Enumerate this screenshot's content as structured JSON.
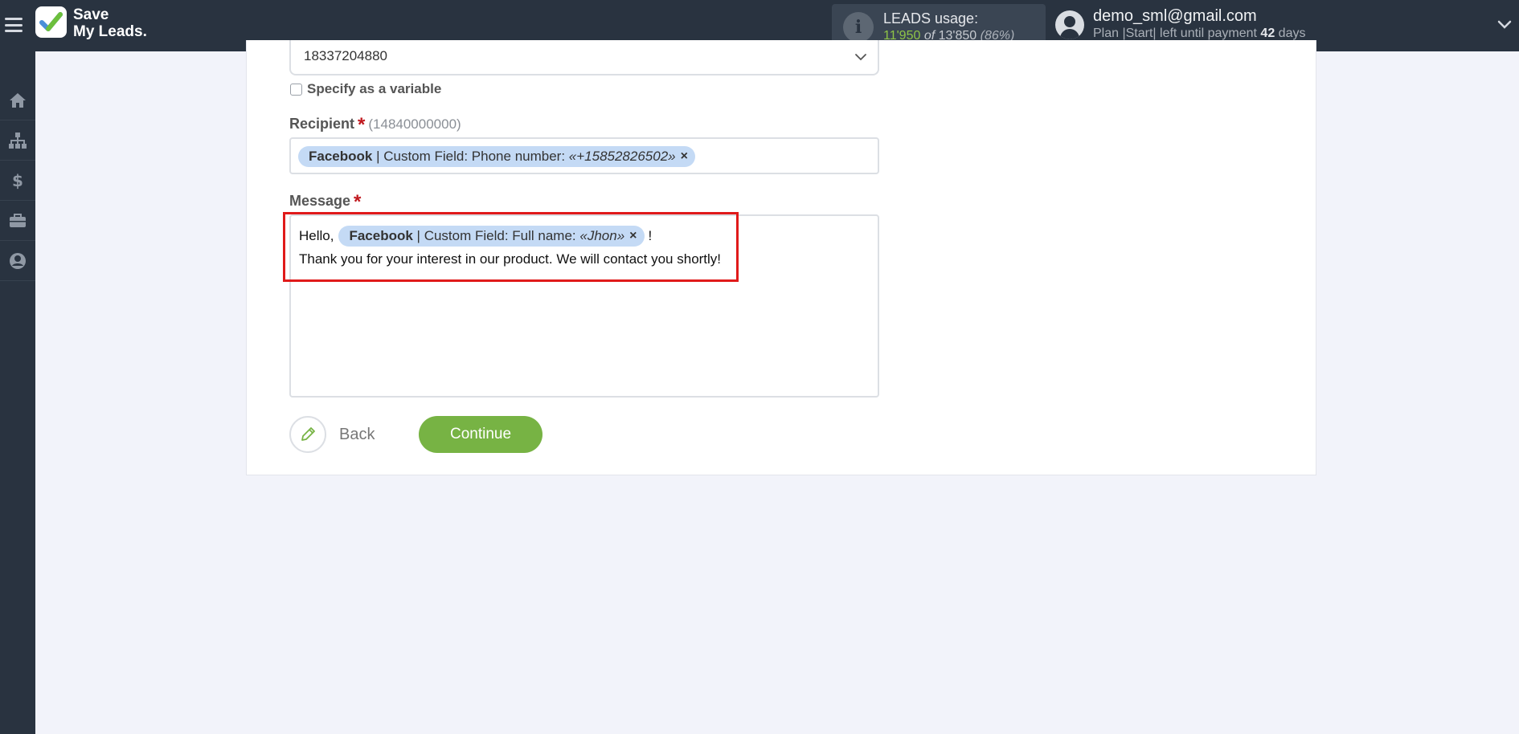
{
  "brand": {
    "line1": "Save",
    "line2": "My Leads."
  },
  "usage": {
    "title": "LEADS usage:",
    "used": "11'950",
    "of_word": "of",
    "total": "13'850",
    "percent": "(86%)"
  },
  "user": {
    "email": "demo_sml@gmail.com",
    "plan_prefix": "Plan |Start| left until payment",
    "days_count": "42",
    "days_word": "days"
  },
  "sidebar": {
    "items": [
      {
        "name": "home",
        "icon": "home-icon"
      },
      {
        "name": "connections",
        "icon": "sitemap-icon"
      },
      {
        "name": "billing",
        "icon": "dollar-icon"
      },
      {
        "name": "tools",
        "icon": "briefcase-icon"
      },
      {
        "name": "account",
        "icon": "user-circle-icon"
      }
    ]
  },
  "form": {
    "sender_value": "18337204880",
    "specify_variable_label": "Specify as a variable",
    "recipient": {
      "label": "Recipient",
      "required_mark": "*",
      "hint": "(14840000000)",
      "chip": {
        "source": "Facebook",
        "field": " | Custom Field: Phone number: ",
        "value": "«+15852826502»",
        "remove": "×"
      }
    },
    "message": {
      "label": "Message",
      "required_mark": "*",
      "prefix": "Hello,",
      "chip": {
        "source": "Facebook",
        "field": " | Custom Field: Full name: ",
        "value": "«Jhon»",
        "remove": "×"
      },
      "suffix": "!",
      "line2": "Thank you for your interest in our product. We will contact you shortly!"
    },
    "back_label": "Back",
    "continue_label": "Continue"
  },
  "colors": {
    "topbar": "#293340",
    "accent_green": "#77b344",
    "chip_bg": "#c4daf5",
    "highlight": "#e01a1a",
    "required": "#c0181e"
  }
}
